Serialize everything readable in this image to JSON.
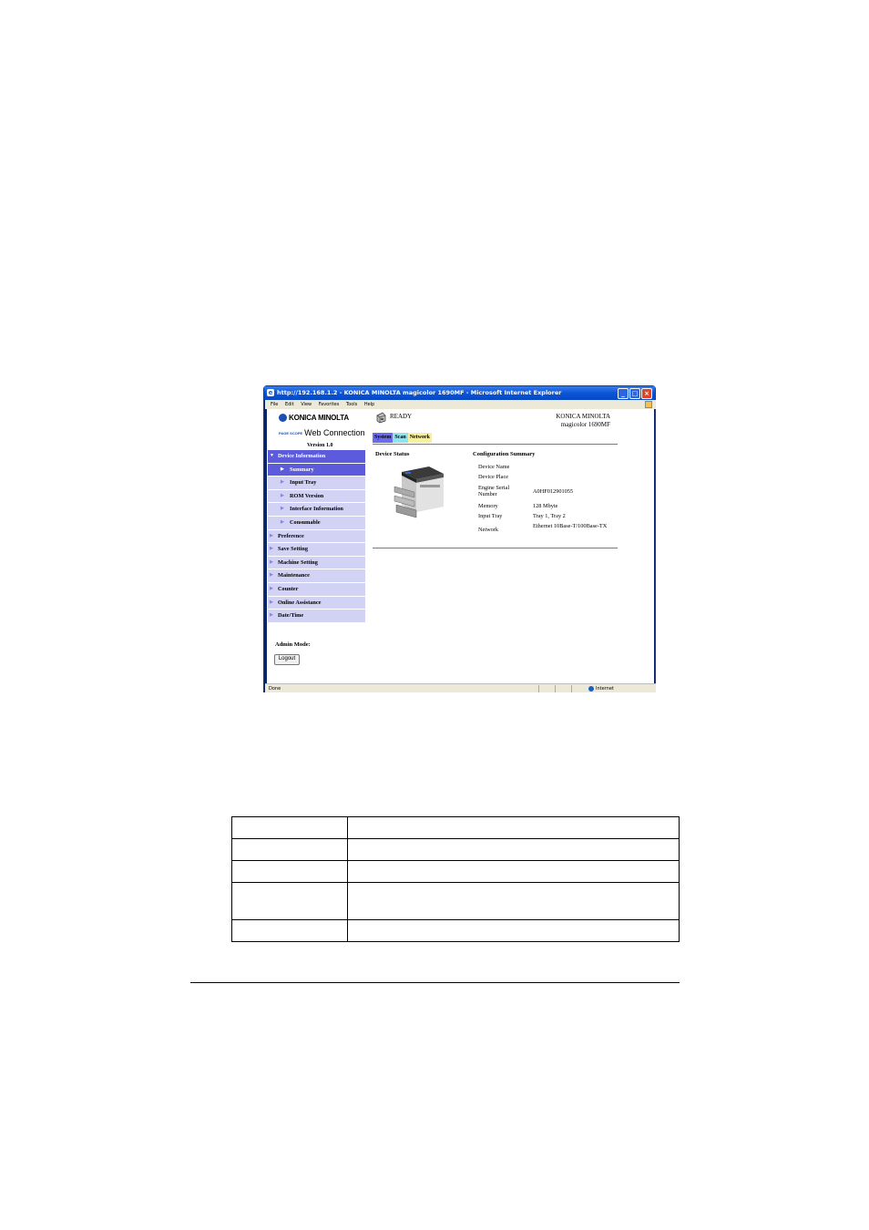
{
  "window": {
    "title": "http://192.168.1.2 - KONICA MINOLTA magicolor 1690MF - Microsoft Internet Explorer",
    "menu": [
      "File",
      "Edit",
      "View",
      "Favorites",
      "Tools",
      "Help"
    ],
    "status_left": "Done",
    "status_zone": "Internet"
  },
  "header": {
    "logo_text": "KONICA MINOLTA",
    "pagescope": "PAGE SCOPE",
    "webconn": "Web Connection",
    "version": "Version 1.0",
    "status": "READY",
    "brand_line1": "KONICA MINOLTA",
    "brand_line2": "magicolor 1690MF"
  },
  "tabs": [
    "System",
    "Scan",
    "Network"
  ],
  "nav": {
    "device_information": "Device Information",
    "summary": "Summary",
    "input_tray": "Input Tray",
    "rom_version": "ROM Version",
    "interface_information": "Interface Information",
    "consumable": "Consumable",
    "preference": "Preference",
    "save_setting": "Save Setting",
    "machine_setting": "Machine Setting",
    "maintenance": "Maintenance",
    "counter": "Counter",
    "online_assistance": "Online Assistance",
    "date_time": "Date/Time"
  },
  "admin_mode": "Admin Mode:",
  "logout": "Logout",
  "main": {
    "device_status_title": "Device Status",
    "config_title": "Configuration Summary",
    "config": [
      {
        "label": "Device Name",
        "value": ""
      },
      {
        "label": "Device Place",
        "value": ""
      },
      {
        "label": "Engine Serial Number",
        "value": "A0HF012901055"
      },
      {
        "label": "Memory",
        "value": "128 Mbyte"
      },
      {
        "label": "Input Tray",
        "value": "Tray 1, Tray 2"
      },
      {
        "label": "Network",
        "value": "Ethernet 10Base-T/100Base-TX"
      }
    ]
  },
  "colors": {
    "nav_bg": "#d2d2f5",
    "nav_active": "#5b5bdb",
    "tab_system": "#6b6bf0",
    "tab_scan": "#8ee4ef",
    "tab_network": "#f7f19b",
    "titlebar": "#0a55d8"
  }
}
